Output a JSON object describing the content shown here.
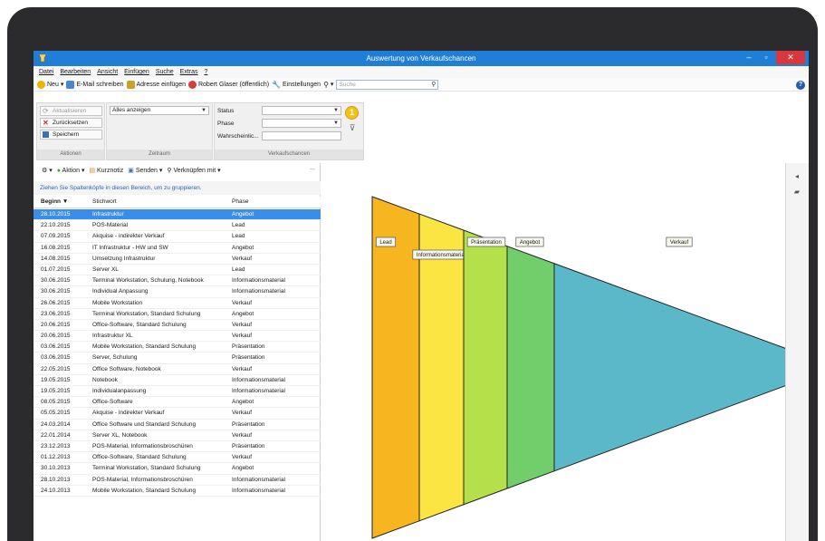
{
  "window": {
    "title": "Auswertung von Verkaufschancen"
  },
  "menu": [
    "Datei",
    "Bearbeiten",
    "Ansicht",
    "Einfügen",
    "Suche",
    "Extras",
    "?"
  ],
  "toolbar": {
    "new": "Neu",
    "email": "E-Mail schreiben",
    "address": "Adresse einfügen",
    "user": "Robert Glaser (öffentlich)",
    "settings": "Einstellungen",
    "search_placeholder": "Suche"
  },
  "ribbon": {
    "refresh": "Aktualisieren",
    "reset": "Zurücksetzen",
    "save": "Speichern",
    "group_actions": "Aktionen",
    "period_value": "Alles anzeigen",
    "group_period": "Zeitraum",
    "status_label": "Status",
    "phase_label": "Phase",
    "prob_label": "Wahrscheinlic...",
    "group_sales": "Verkaufschancen",
    "badge": "1"
  },
  "listtools": {
    "action": "Aktion",
    "note": "Kurznotiz",
    "send": "Senden",
    "link": "Verknüpfen mit",
    "more": "..."
  },
  "grouphint": "Ziehen Sie Spaltenköpfe in diesen Bereich, um zu gruppieren.",
  "table": {
    "headers": [
      "Beginn",
      "Stichwort",
      "Phase"
    ],
    "rows": [
      [
        "28.10.2015",
        "Infrastruktur",
        "Angebot"
      ],
      [
        "22.10.2015",
        "POS-Material",
        "Lead"
      ],
      [
        "07.09.2015",
        "Akquise - indirekter Verkauf",
        "Lead"
      ],
      [
        "16.08.2015",
        "IT Infrastruktur - HW und SW",
        "Angebot"
      ],
      [
        "14.08.2015",
        "Umsetzung Infrastruktur",
        "Verkauf"
      ],
      [
        "01.07.2015",
        "Server XL",
        "Lead"
      ],
      [
        "30.06.2015",
        "Terminal Workstation, Schulung, Notebook",
        "Informationsmaterial"
      ],
      [
        "30.06.2015",
        "Individual Anpassung",
        "Informationsmaterial"
      ],
      [
        "26.06.2015",
        "Mobile Workstation",
        "Verkauf"
      ],
      [
        "23.06.2015",
        "Terminal Workstation, Standard Schulung",
        "Angebot"
      ],
      [
        "20.06.2015",
        "Office-Software, Standard Schulung",
        "Verkauf"
      ],
      [
        "20.06.2015",
        "Infrastruktur XL",
        "Verkauf"
      ],
      [
        "03.06.2015",
        "Mobile Workstation, Standard Schulung",
        "Präsentation"
      ],
      [
        "03.06.2015",
        "Server, Schulung",
        "Präsentation"
      ],
      [
        "22.05.2015",
        "Office Software, Notebook",
        "Verkauf"
      ],
      [
        "19.05.2015",
        "Notebook",
        "Informationsmaterial"
      ],
      [
        "19.05.2015",
        "Individualanpassung",
        "Informationsmaterial"
      ],
      [
        "08.05.2015",
        "Office-Software",
        "Angebot"
      ],
      [
        "05.05.2015",
        "Akquise - indirekter Verkauf",
        "Verkauf"
      ],
      [
        "24.03.2014",
        "Office Software und Standard Schulung",
        "Präsentation"
      ],
      [
        "22.01.2014",
        "Server XL, Notebook",
        "Verkauf"
      ],
      [
        "23.12.2013",
        "POS-Material, Informationsbroschüren",
        "Präsentation"
      ],
      [
        "01.12.2013",
        "Office-Software, Standard Schulung",
        "Verkauf"
      ],
      [
        "30.10.2013",
        "Terminal Workstation, Standard Schulung",
        "Angebot"
      ],
      [
        "28.10.2013",
        "POS-Material, Informationsbroschüren",
        "Informationsmaterial"
      ],
      [
        "24.10.2013",
        "Mobile Workstation, Standard Schulung",
        "Informationsmaterial"
      ]
    ]
  },
  "funnel": {
    "stages": [
      {
        "label": "Lead",
        "color": "#f7b51f"
      },
      {
        "label": "Informationsmaterial",
        "color": "#fae542"
      },
      {
        "label": "Präsentation",
        "color": "#b6e04a"
      },
      {
        "label": "Angebot",
        "color": "#72cd6b"
      },
      {
        "label": "Verkauf",
        "color": "#5ab8c8"
      }
    ]
  }
}
